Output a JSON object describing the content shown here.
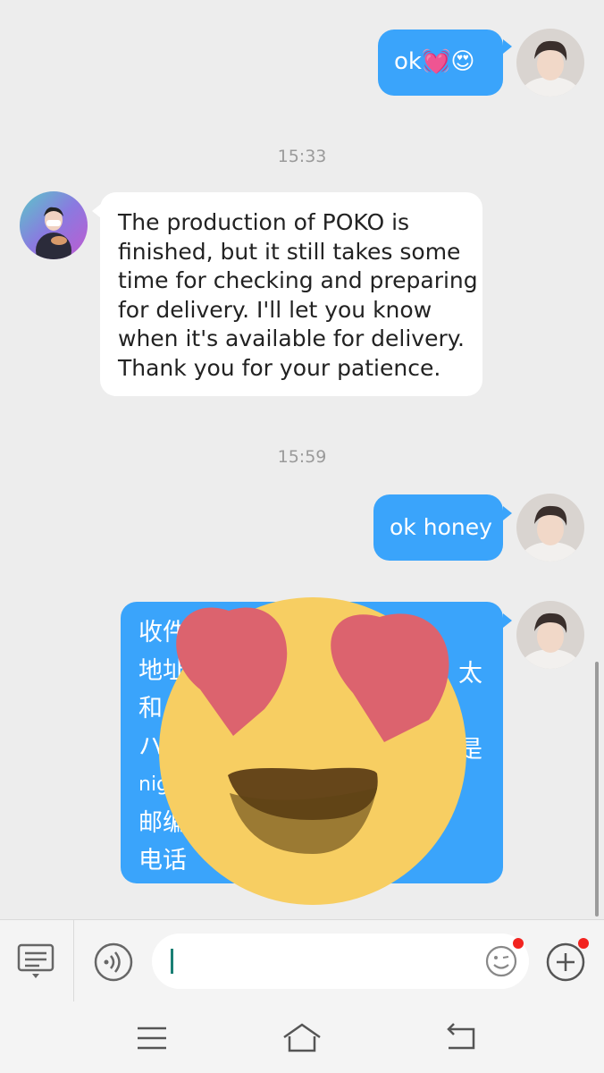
{
  "messages": [
    {
      "id": "m1",
      "side": "out",
      "text": "ok💓😍"
    },
    {
      "id": "t1",
      "type": "time",
      "text": "15:33"
    },
    {
      "id": "m2",
      "side": "in",
      "lines": [
        "The production of POKO is",
        "finished, but it still takes some",
        "time for checking and preparing",
        "for delivery. I'll let you know",
        "when it's available for delivery.",
        "Thank you for your patience."
      ]
    },
    {
      "id": "t2",
      "type": "time",
      "text": "15:59"
    },
    {
      "id": "m3",
      "side": "out",
      "text": "ok honey"
    },
    {
      "id": "m4",
      "side": "out",
      "lines": [
        "收件",
        "地址",
        "和",
        "ハ",
        "nig",
        "邮编",
        "电话"
      ],
      "fragments": [
        "太",
        "是"
      ],
      "overlay": "heart-eyes-emoji-sticker"
    }
  ],
  "input": {
    "value": "",
    "placeholder": ""
  },
  "colors": {
    "out_bubble": "#3aa4fb",
    "in_bubble": "#ffffff",
    "background": "#ededed",
    "badge": "#f2231f"
  },
  "icons": [
    "keyboard-icon",
    "voice-icon",
    "emoji-icon",
    "add-icon",
    "menu-icon",
    "home-icon",
    "back-icon"
  ]
}
